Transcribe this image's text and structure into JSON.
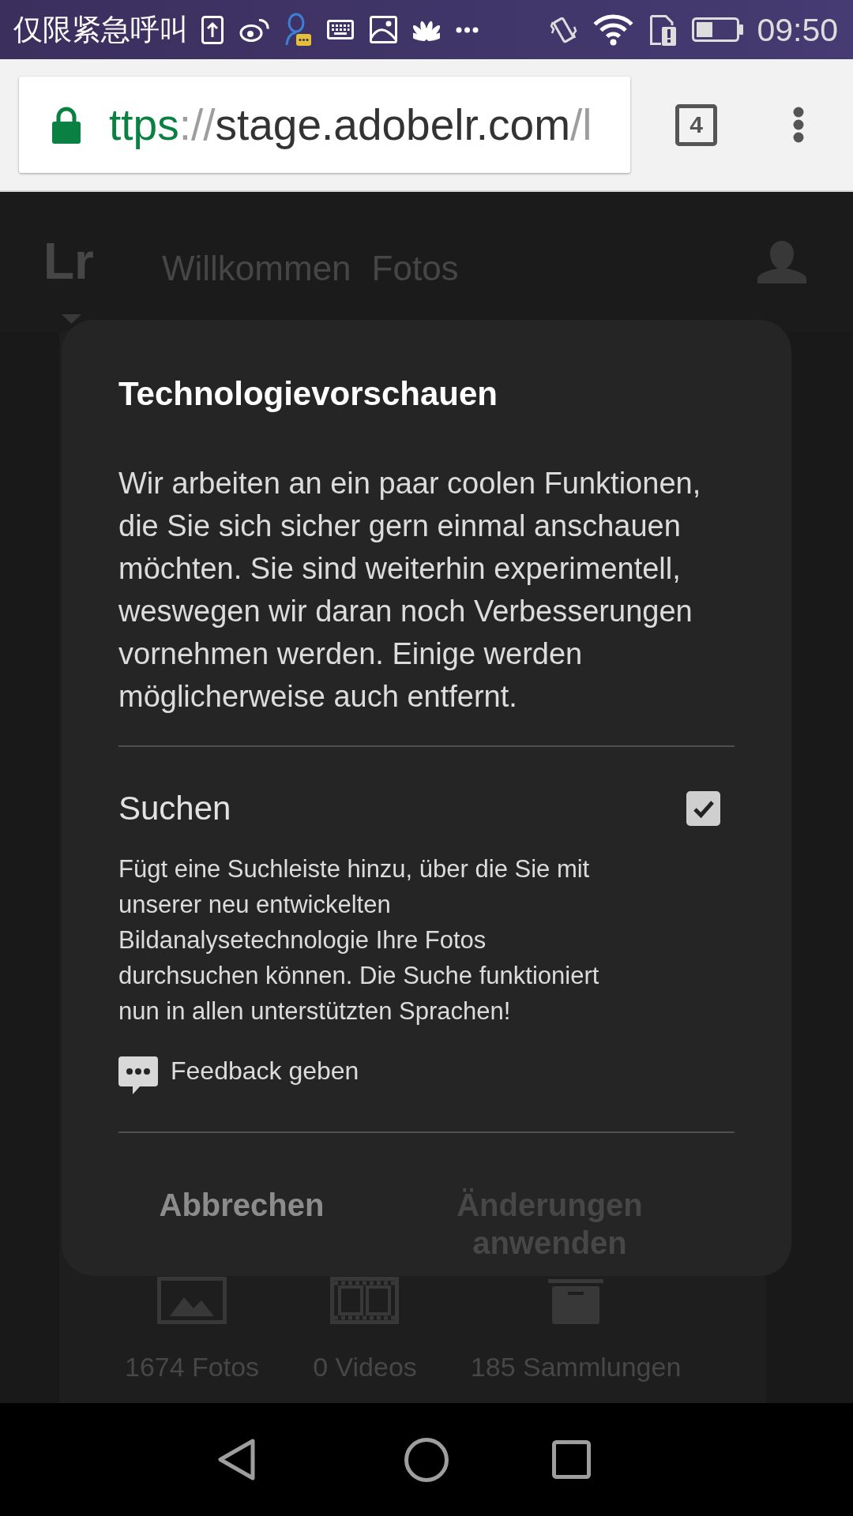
{
  "status_bar": {
    "carrier_text": "仅限紧急呼叫",
    "time": "09:50"
  },
  "browser": {
    "secure": true,
    "url_parts": [
      {
        "text": "ttps",
        "kind": "scheme"
      },
      {
        "text": "://",
        "kind": "separator"
      },
      {
        "text": "stage.adobelr.com",
        "kind": "host"
      },
      {
        "text": "/l",
        "kind": "path"
      }
    ],
    "tab_count": "4"
  },
  "app_header": {
    "logo": "Lr",
    "nav_items": [
      {
        "label": "Willkommen"
      },
      {
        "label": "Fotos"
      }
    ]
  },
  "library_stats": [
    {
      "kind": "photos",
      "label": "1674 Fotos"
    },
    {
      "kind": "videos",
      "label": "0 Videos"
    },
    {
      "kind": "collections",
      "label": "185 Sammlungen"
    }
  ],
  "dialog": {
    "title": "Technologievorschauen",
    "message": "Wir arbeiten an ein paar coolen Funktionen, die Sie sich sicher gern einmal anschauen möchten. Sie sind weiterhin experimentell, weswegen wir daran noch Verbesserungen vornehmen werden. Einige werden möglicherweise auch entfernt.",
    "features": [
      {
        "name": "Suchen",
        "checked": true,
        "description": "Fügt eine Suchleiste hinzu, über die Sie mit unserer neu entwickelten Bildanalysetechnologie Ihre Fotos durchsuchen können. Die Suche funktioniert nun in allen unterstützten Sprachen!",
        "feedback_link": "Feedback geben"
      }
    ],
    "buttons": [
      {
        "label": "Abbrechen",
        "disabled": false
      },
      {
        "label": "Änderungen anwenden",
        "disabled": true
      }
    ]
  }
}
